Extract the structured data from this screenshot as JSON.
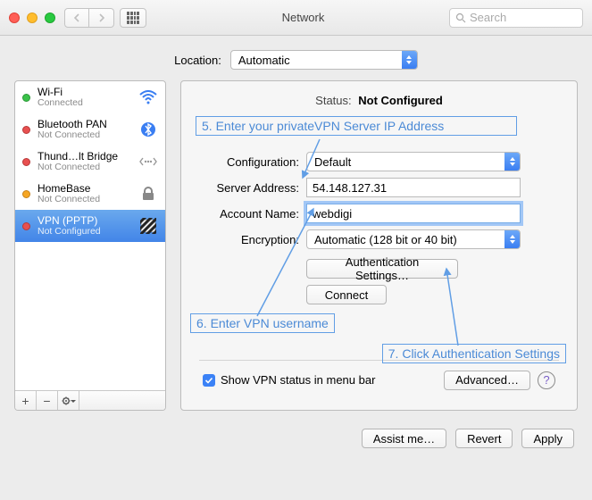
{
  "titlebar": {
    "title": "Network",
    "search_placeholder": "Search"
  },
  "location": {
    "label": "Location:",
    "value": "Automatic"
  },
  "services": [
    {
      "name": "Wi-Fi",
      "status": "Connected",
      "dot": "green",
      "icon": "wifi"
    },
    {
      "name": "Bluetooth PAN",
      "status": "Not Connected",
      "dot": "red",
      "icon": "bluetooth"
    },
    {
      "name": "Thund…lt Bridge",
      "status": "Not Connected",
      "dot": "red",
      "icon": "thunderbolt"
    },
    {
      "name": "HomeBase",
      "status": "Not Connected",
      "dot": "orange",
      "icon": "lock"
    },
    {
      "name": "VPN (PPTP)",
      "status": "Not Configured",
      "dot": "red",
      "icon": "stripes",
      "selected": true
    }
  ],
  "detail": {
    "status_label": "Status:",
    "status_value": "Not Configured",
    "rows": {
      "config_label": "Configuration:",
      "config_value": "Default",
      "server_label": "Server Address:",
      "server_value": "54.148.127.31",
      "account_label": "Account Name:",
      "account_value": "webdigi",
      "encryption_label": "Encryption:",
      "encryption_value": "Automatic (128 bit or 40 bit)"
    },
    "buttons": {
      "auth": "Authentication Settings…",
      "connect": "Connect"
    },
    "show_menu_bar": "Show VPN status in menu bar",
    "advanced": "Advanced…"
  },
  "annotations": {
    "step5": "5. Enter your privateVPN Server IP Address",
    "step6": "6. Enter VPN username",
    "step7": "7. Click Authentication Settings"
  },
  "footer": {
    "assist": "Assist me…",
    "revert": "Revert",
    "apply": "Apply"
  }
}
